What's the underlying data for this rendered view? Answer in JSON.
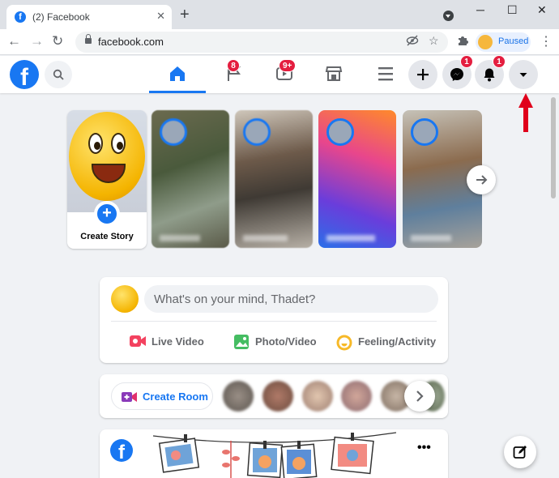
{
  "browser": {
    "tab_title": "(2) Facebook",
    "tab_favicon": "f",
    "url": "facebook.com",
    "profile_label": "Paused"
  },
  "fb": {
    "logo_letter": "f",
    "nav": {
      "pages_badge": "8",
      "watch_badge": "9+"
    },
    "actions": {
      "messenger_badge": "1",
      "notifications_badge": "1"
    },
    "stories": {
      "create_label": "Create Story"
    },
    "composer": {
      "placeholder": "What's on your mind, Thadet?",
      "actions": [
        {
          "label": "Live Video",
          "icon": "live-video-icon",
          "color": "#f3425f"
        },
        {
          "label": "Photo/Video",
          "icon": "photo-video-icon",
          "color": "#45bd62"
        },
        {
          "label": "Feeling/Activity",
          "icon": "feeling-activity-icon",
          "color": "#f7b928"
        }
      ]
    },
    "rooms": {
      "create_room_label": "Create Room"
    },
    "post": {
      "more_label": "•••"
    }
  },
  "colors": {
    "brand": "#1877f2",
    "badge": "#e41e3f",
    "page_bg": "#f0f2f5",
    "annotation_arrow": "#e0001b"
  }
}
